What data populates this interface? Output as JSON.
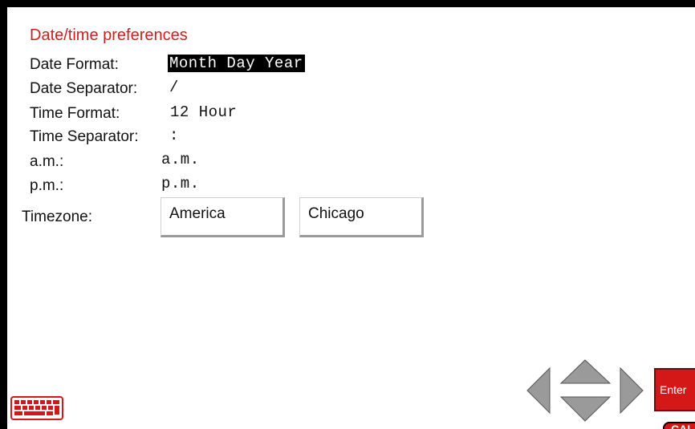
{
  "title": "Date/time preferences",
  "fields": {
    "date_format": {
      "label": "Date Format:",
      "value": "Month Day Year"
    },
    "date_separator": {
      "label": "Date Separator:",
      "value": "/"
    },
    "time_format": {
      "label": "Time Format:",
      "value": "12 Hour"
    },
    "time_separator": {
      "label": "Time Separator:",
      "value": ":"
    },
    "am": {
      "label": "a.m.:",
      "value": "a.m."
    },
    "pm": {
      "label": "p.m.:",
      "value": "p.m."
    }
  },
  "timezone": {
    "label": "Timezone:",
    "region": "America",
    "city": "Chicago"
  },
  "controls": {
    "enter_label": "Enter",
    "cal_label": "CAL",
    "keyboard_icon": "keyboard-icon",
    "arrow_icons": [
      "left-arrow-icon",
      "up-arrow-icon",
      "down-arrow-icon",
      "right-arrow-icon"
    ]
  },
  "colors": {
    "accent": "#cc1f1f",
    "button_red": "#d41818",
    "selection_bg": "#000000",
    "arrow_gray": "#9a9a9a"
  }
}
